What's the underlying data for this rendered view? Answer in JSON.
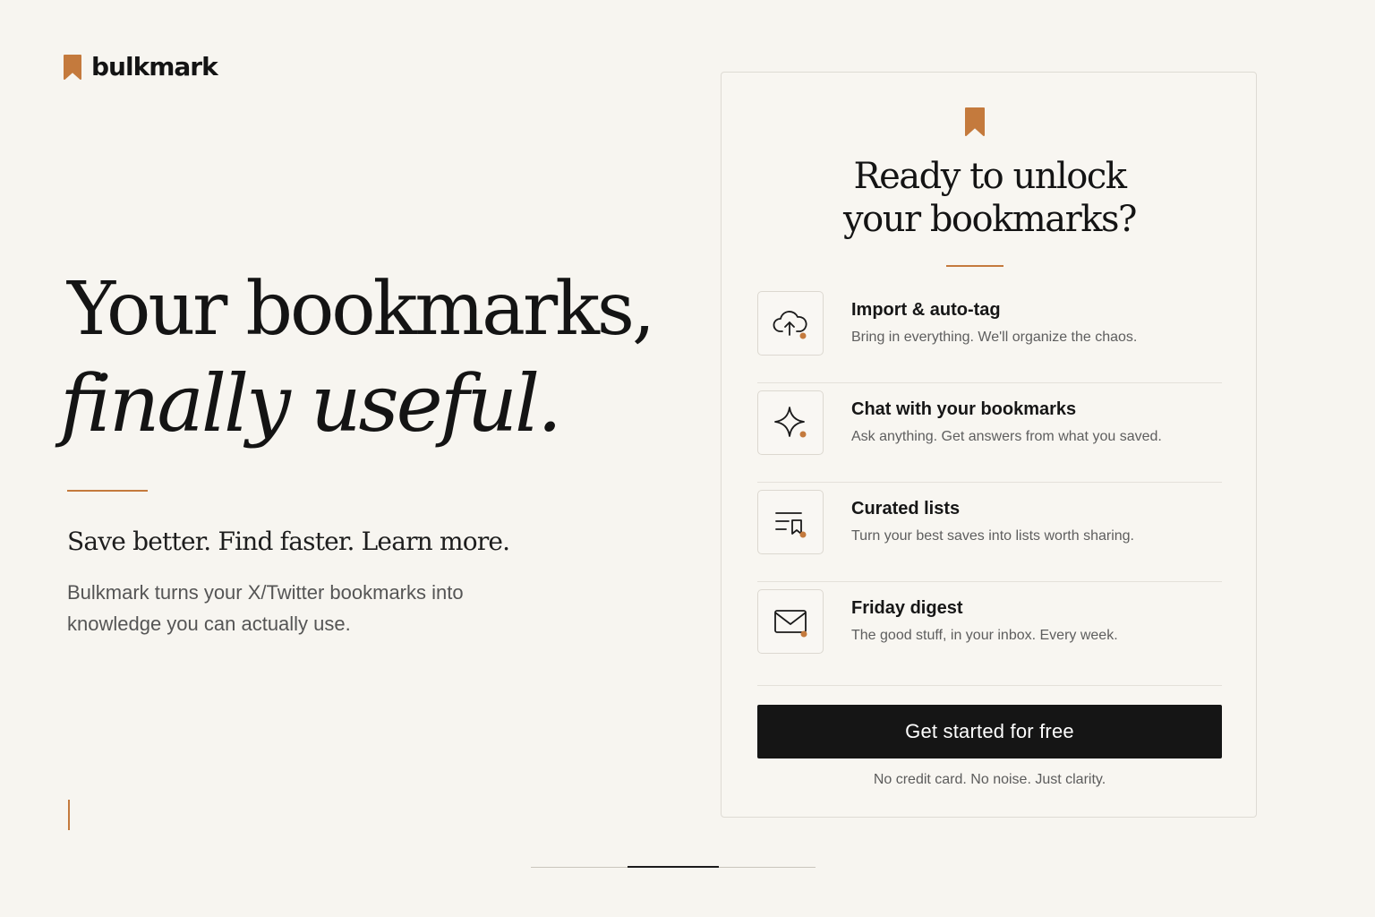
{
  "brand": {
    "name": "bulkmark",
    "accent_color": "#c47a3d",
    "logo_icon": "bookmark-icon"
  },
  "hero": {
    "headline_line1": "Your bookmarks,",
    "headline_line2": "finally useful.",
    "tagline": "Save better. Find faster. Learn more.",
    "description": "Bulkmark turns your X/Twitter bookmarks into knowledge you can actually use."
  },
  "card": {
    "icon": "bookmark-icon",
    "title_line1": "Ready to unlock",
    "title_line2": "your bookmarks?",
    "features": [
      {
        "icon": "cloud-upload-icon",
        "title": "Import & auto-tag",
        "text": "Bring in everything. We'll organize the chaos."
      },
      {
        "icon": "sparkle-icon",
        "title": "Chat with your bookmarks",
        "text": "Ask anything. Get answers from what you saved."
      },
      {
        "icon": "list-bookmark-icon",
        "title": "Curated lists",
        "text": "Turn your best saves into lists worth sharing."
      },
      {
        "icon": "mail-icon",
        "title": "Friday digest",
        "text": "The good stuff, in your inbox. Every week."
      }
    ],
    "cta_label": "Get started for free",
    "fine_print": "No credit card. No noise. Just clarity."
  },
  "carousel": {
    "current_slide": 2,
    "total_slides": 3
  },
  "colors": {
    "background": "#f7f5f0",
    "text": "#141414",
    "button": "#151515"
  }
}
